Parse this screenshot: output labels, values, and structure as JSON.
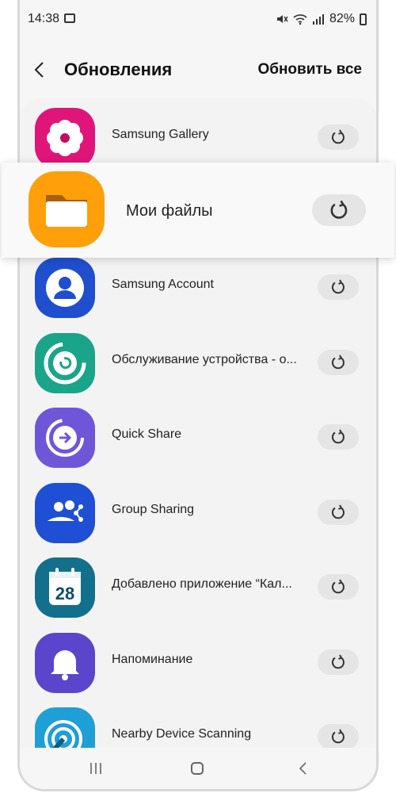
{
  "status_bar": {
    "time": "14:38",
    "battery": "82%"
  },
  "header": {
    "title": "Обновления",
    "update_all": "Обновить все"
  },
  "apps": [
    {
      "name": "Samsung Gallery",
      "icon": "gallery-flower-icon",
      "color": "#e0157a"
    },
    {
      "name": "Мои файлы",
      "icon": "folder-icon",
      "color": "#ff9f0a"
    },
    {
      "name": "Samsung Account",
      "icon": "account-icon",
      "color": "#1f4fcf"
    },
    {
      "name": "Обслуживание устройства - о...",
      "icon": "device-care-icon",
      "color": "#1aa58a"
    },
    {
      "name": "Quick Share",
      "icon": "quick-share-icon",
      "color": "#6f56d9"
    },
    {
      "name": "Group Sharing",
      "icon": "group-sharing-icon",
      "color": "#1e4fd4"
    },
    {
      "name": "Добавлено приложение “Кал...",
      "icon": "calendar-icon",
      "color": "#13708c",
      "calendar_day": "28"
    },
    {
      "name": "Напоминание",
      "icon": "bell-icon",
      "color": "#5a45cc"
    },
    {
      "name": "Nearby Device Scanning",
      "icon": "nearby-scan-icon",
      "color": "#1e9fd6"
    }
  ],
  "popup": {
    "name": "Мои файлы",
    "icon": "folder-icon",
    "color": "#ff9f0a"
  }
}
